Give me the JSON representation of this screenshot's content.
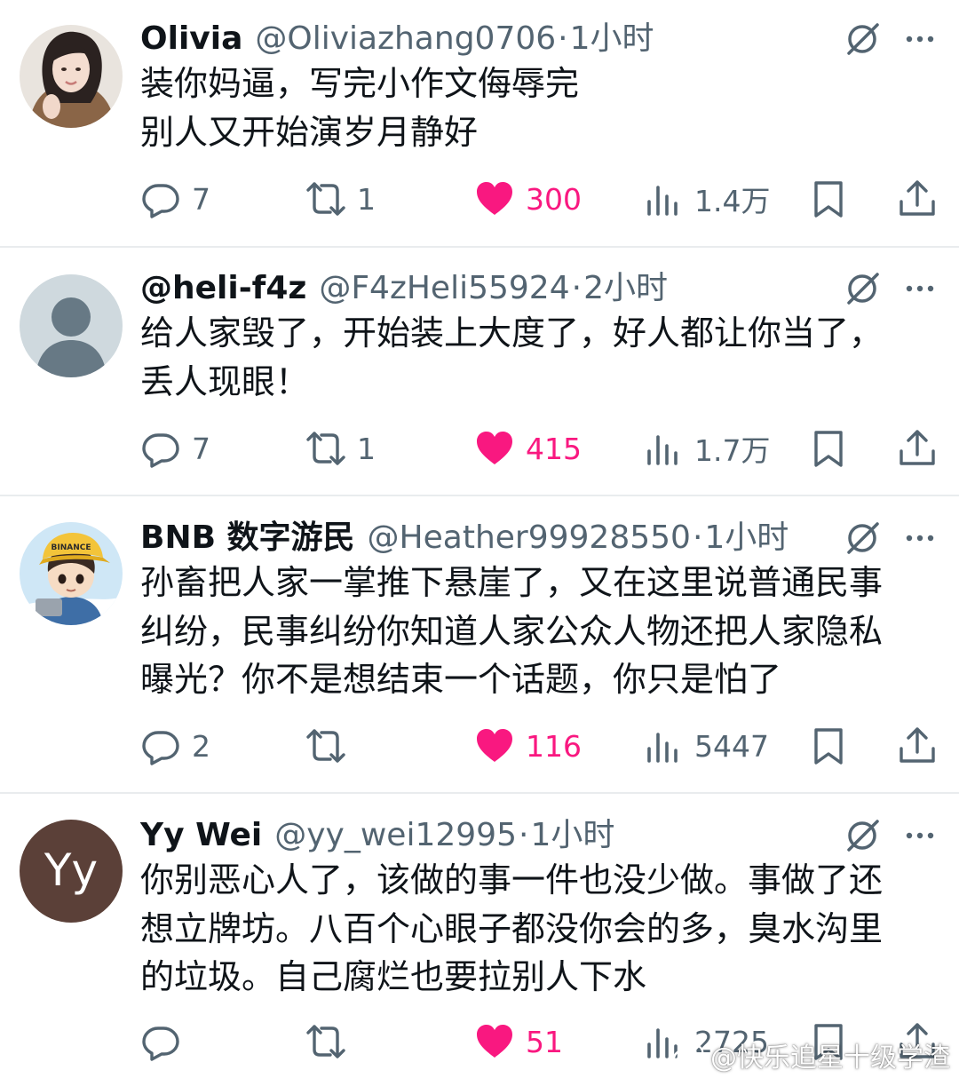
{
  "tweets": [
    {
      "display_name": "Olivia",
      "handle": "@Oliviazhang0706",
      "time": "1小时",
      "text": "装你妈逼，写完小作文侮辱完\n别人又开始演岁月静好",
      "replies": "7",
      "retweets": "1",
      "likes": "300",
      "views": "1.4万",
      "avatar": "photo-woman-icon"
    },
    {
      "display_name": "@heli-f4z",
      "handle": "@F4zHeli55924",
      "time": "2小时",
      "text": "给人家毁了，开始装上大度了，好人都让你当了，\n丢人现眼！",
      "replies": "7",
      "retweets": "1",
      "likes": "415",
      "views": "1.7万",
      "avatar": "default-user-icon"
    },
    {
      "display_name": "BNB 数字游民",
      "handle": "@Heather99928550",
      "time": "1小时",
      "text": "孙畜把人家一掌推下悬崖了，又在这里说普通民事\n纠纷，民事纠纷你知道人家公众人物还把人家隐私\n曝光？你不是想结束一个话题，你只是怕了",
      "replies": "2",
      "retweets": "",
      "likes": "116",
      "views": "5447",
      "avatar": "cartoon-boy-binance-cap-icon",
      "avatar_cap_text": "BINANCE"
    },
    {
      "display_name": "Yy Wei",
      "handle": "@yy_wei12995",
      "time": "1小时",
      "text": "你别恶心人了，该做的事一件也没少做。事做了还\n想立牌坊。八百个心眼子都没你会的多，臭水沟里\n的垃圾。自己腐烂也要拉别人下水",
      "replies": "",
      "retweets": "",
      "likes": "51",
      "views": "2725",
      "avatar": "initials-avatar",
      "avatar_initials": "Yy"
    }
  ],
  "dot": "·",
  "watermark": "@快乐追星十级学渣",
  "icons": [
    "grok-icon",
    "more-icon",
    "reply-icon",
    "retweet-icon",
    "like-icon",
    "views-icon",
    "bookmark-icon",
    "share-icon",
    "weibo-icon"
  ],
  "colors": {
    "like": "#f91880",
    "secondary_text": "#536471",
    "primary_text": "#0f1419",
    "divider": "#e9ecee",
    "initials_avatar_bg": "#5b4038"
  }
}
